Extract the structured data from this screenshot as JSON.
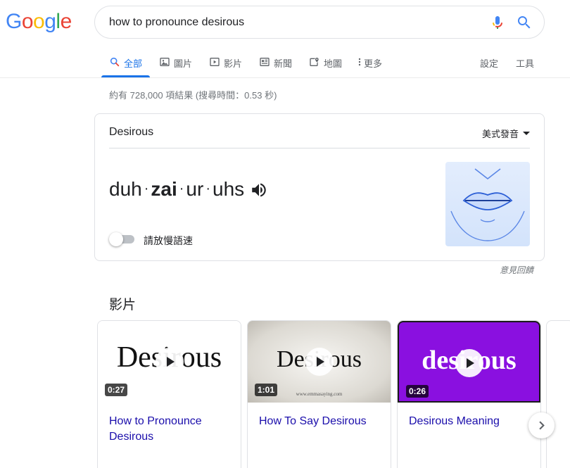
{
  "logo": {
    "letters": [
      "G",
      "o",
      "o",
      "g",
      "l",
      "e"
    ],
    "colors": [
      "#4285f4",
      "#ea4335",
      "#fbbc05",
      "#4285f4",
      "#34a853",
      "#ea4335"
    ]
  },
  "search": {
    "query": "how to pronounce desirous"
  },
  "tabs": [
    {
      "label": "全部",
      "icon": "search-icon",
      "active": true
    },
    {
      "label": "圖片",
      "icon": "image-icon"
    },
    {
      "label": "影片",
      "icon": "video-icon"
    },
    {
      "label": "新聞",
      "icon": "news-icon"
    },
    {
      "label": "地圖",
      "icon": "map-icon"
    },
    {
      "label": "更多",
      "icon": "more-vert-icon"
    }
  ],
  "tools": {
    "settings": "設定",
    "tools": "工具"
  },
  "stats": "約有 728,000 項結果 (搜尋時間：0.53 秒)",
  "pronunciation": {
    "word": "Desirous",
    "accent": "美式發音",
    "syllables": [
      {
        "text": "duh",
        "stressed": false
      },
      {
        "text": "zai",
        "stressed": true
      },
      {
        "text": "ur",
        "stressed": false
      },
      {
        "text": "uhs",
        "stressed": false
      }
    ],
    "slow_label": "請放慢語速",
    "slow_enabled": false
  },
  "feedback": "意見回饋",
  "videos": {
    "heading": "影片",
    "items": [
      {
        "title": "How to Pronounce Desirous",
        "duration": "0:27",
        "thumb_text": "Desirous",
        "thumb_bg": "#ffffff",
        "thumb_color": "#111111"
      },
      {
        "title": "How To Say Desirous",
        "duration": "1:01",
        "thumb_text": "Desirous",
        "thumb_bg": "#e6e4df",
        "thumb_color": "#111111",
        "thumb_caption": "www.emmasaying.com"
      },
      {
        "title": "Desirous Meaning",
        "duration": "0:26",
        "thumb_text": "desirous",
        "thumb_bg": "#8a10e0",
        "thumb_color": "#ffffff"
      }
    ]
  },
  "colors": {
    "link": "#1a0dab",
    "accent": "#1a73e8",
    "meta": "#70757a"
  }
}
